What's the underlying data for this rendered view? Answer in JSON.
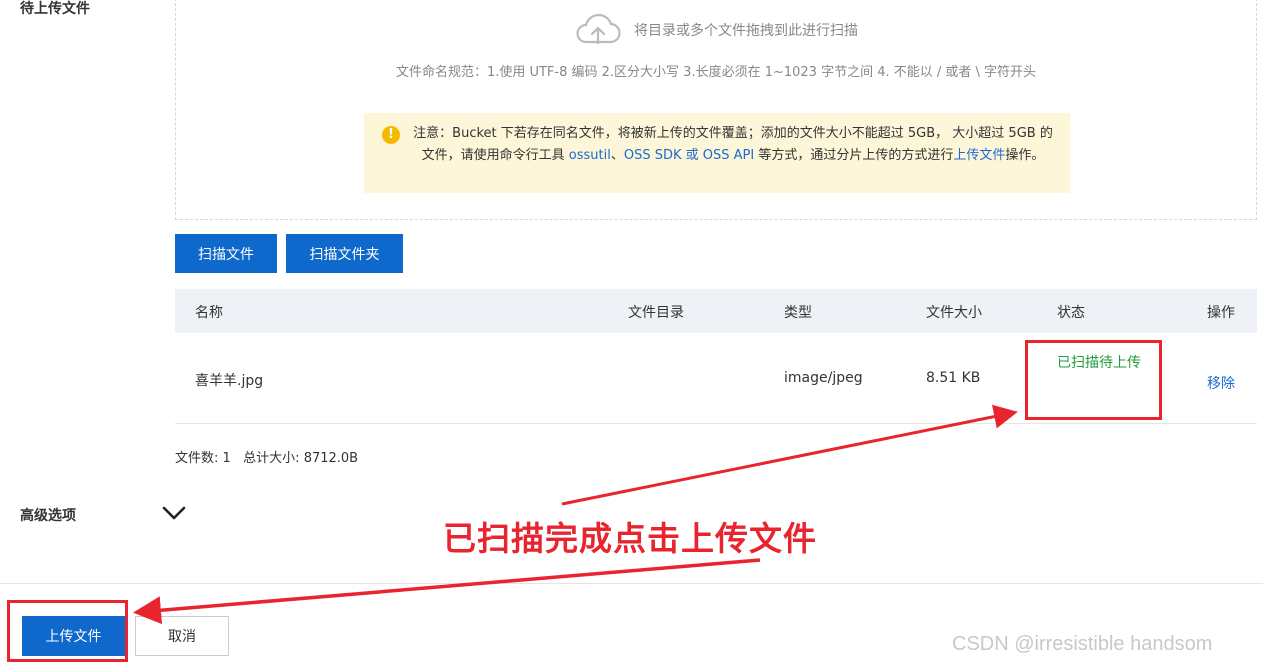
{
  "sections": {
    "pending_files": "待上传文件",
    "advanced_options": "高级选项"
  },
  "dropzone": {
    "hint": "将目录或多个文件拖拽到此进行扫描",
    "naming_rule": "文件命名规范：1.使用 UTF-8 编码 2.区分大小写 3.长度必须在 1~1023 字节之间 4. 不能以 / 或者 \\ 字符开头",
    "notice_part1": "注意：Bucket 下若存在同名文件，将被新上传的文件覆盖；添加的文件大小不能超过 5GB， 大小超过 5GB 的文件，请使用命令行工具 ",
    "notice_link1": "ossutil",
    "notice_sep": "、",
    "notice_link2": "OSS SDK",
    "notice_or": " 或 ",
    "notice_link3": "OSS API",
    "notice_part2": " 等方式，通过分片上传的方式进行",
    "notice_link4": "上传文件",
    "notice_part3": "操作。"
  },
  "buttons": {
    "scan_file": "扫描文件",
    "scan_folder": "扫描文件夹",
    "upload": "上传文件",
    "cancel": "取消"
  },
  "table": {
    "columns": [
      "名称",
      "文件目录",
      "类型",
      "文件大小",
      "状态",
      "操作"
    ],
    "rows": [
      {
        "name": "喜羊羊.jpg",
        "directory": "",
        "type": "image/jpeg",
        "size": "8.51 KB",
        "status": "已扫描待上传",
        "action": "移除"
      }
    ]
  },
  "summary": "文件数: 1   总计大小: 8712.0B",
  "annotation": "已扫描完成点击上传文件",
  "watermark": "CSDN @irresistible handsom",
  "colors": {
    "primary": "#0f69cc",
    "success": "#1e9e3c",
    "annotation_red": "#e8242f",
    "notice_bg": "#fdf6d8"
  },
  "icons": [
    "cloud-upload-icon",
    "warning-icon",
    "chevron-down-icon"
  ]
}
